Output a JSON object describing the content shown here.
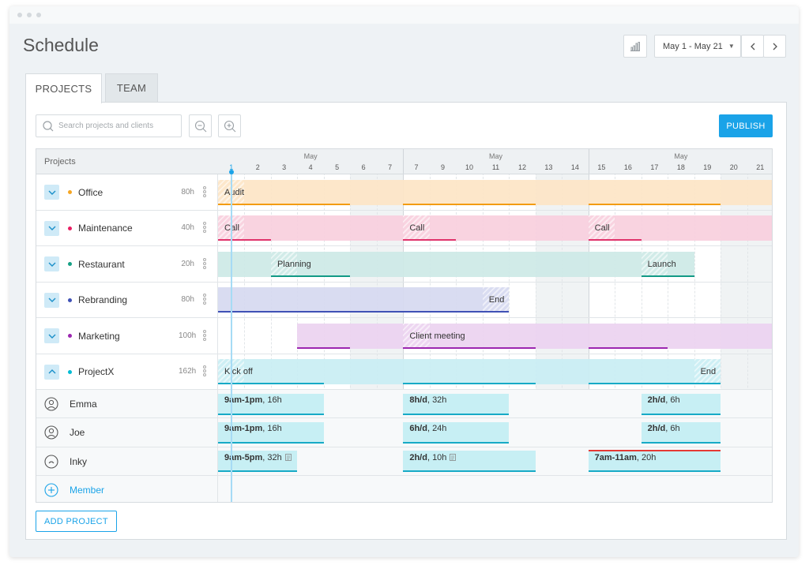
{
  "page": {
    "title": "Schedule"
  },
  "header": {
    "date_range": "May 1 - May 21",
    "prev_icon": "chevron-left-icon",
    "next_icon": "chevron-right-icon",
    "chart_icon": "bar-chart-icon"
  },
  "tabs": [
    {
      "label": "PROJECTS",
      "active": true
    },
    {
      "label": "TEAM",
      "active": false
    }
  ],
  "toolbar": {
    "search_placeholder": "Search projects and clients",
    "publish_label": "PUBLISH",
    "zoom_out_icon": "zoom-out-icon",
    "zoom_in_icon": "zoom-in-icon"
  },
  "grid": {
    "header_label": "Projects",
    "month_label": "May",
    "days": [
      "1",
      "2",
      "3",
      "4",
      "5",
      "6",
      "7",
      "7",
      "9",
      "10",
      "11",
      "12",
      "13",
      "14",
      "15",
      "16",
      "17",
      "18",
      "19",
      "20",
      "21"
    ],
    "weekend_days": [
      6,
      7,
      13,
      14,
      20,
      21
    ],
    "today_day": 1
  },
  "projects": [
    {
      "name": "Office",
      "hours": "80h",
      "color": "#f5a623",
      "expanded": false,
      "bars": [
        {
          "start": 1,
          "end": 21,
          "fill": "#fde5c6",
          "line": "#f39c12",
          "line_segments": [
            [
              1,
              5
            ],
            [
              8,
              12
            ],
            [
              15,
              19
            ]
          ]
        }
      ],
      "labels": [
        {
          "day": 1,
          "text": "Audit"
        }
      ]
    },
    {
      "name": "Maintenance",
      "hours": "40h",
      "color": "#e91e63",
      "expanded": false,
      "bars": [
        {
          "start": 1,
          "end": 21,
          "fill": "#f9cfdd",
          "line": "#e0336b",
          "line_segments": [
            [
              1,
              2
            ],
            [
              8,
              9
            ],
            [
              15,
              16
            ]
          ]
        }
      ],
      "labels": [
        {
          "day": 1,
          "text": "Call"
        },
        {
          "day": 8,
          "text": "Call"
        },
        {
          "day": 15,
          "text": "Call"
        }
      ]
    },
    {
      "name": "Restaurant",
      "hours": "20h",
      "color": "#16a085",
      "expanded": false,
      "bars": [
        {
          "start": 1,
          "end": 18,
          "fill": "#cde9e6",
          "line": "#129a86",
          "line_segments": [
            [
              3,
              5
            ],
            [
              17,
              18
            ]
          ]
        }
      ],
      "labels": [
        {
          "day": 3,
          "text": "Planning"
        },
        {
          "day": 17,
          "text": "Launch"
        }
      ]
    },
    {
      "name": "Rebranding",
      "hours": "80h",
      "color": "#3f51b5",
      "expanded": false,
      "bars": [
        {
          "start": 1,
          "end": 11,
          "fill": "#d6d9f0",
          "line": "#3f51b5",
          "line_segments": [
            [
              1,
              11
            ]
          ]
        }
      ],
      "labels": [
        {
          "day": 11,
          "text": "End"
        }
      ]
    },
    {
      "name": "Marketing",
      "hours": "100h",
      "color": "#9c27b0",
      "expanded": false,
      "bars": [
        {
          "start": 4,
          "end": 21,
          "fill": "#ecd3f0",
          "line": "#9c27b0",
          "line_segments": [
            [
              4,
              5
            ],
            [
              8,
              12
            ],
            [
              15,
              17
            ]
          ]
        }
      ],
      "labels": [
        {
          "day": 8,
          "text": "Client meeting"
        }
      ]
    },
    {
      "name": "ProjectX",
      "hours": "162h",
      "color": "#00bcd4",
      "expanded": true,
      "bars": [
        {
          "start": 1,
          "end": 19,
          "fill": "#c9eef3",
          "line": "#17aac6",
          "line_segments": [
            [
              1,
              4
            ],
            [
              8,
              12
            ],
            [
              15,
              19
            ]
          ]
        }
      ],
      "labels": [
        {
          "day": 1,
          "text": "Kick off"
        },
        {
          "day": 19,
          "text": "End"
        }
      ]
    }
  ],
  "members": [
    {
      "name": "Emma",
      "avatar_icon": "avatar-emma-icon",
      "assignments": [
        {
          "start": 1,
          "end": 4,
          "strong": "9am-1pm",
          "rest": ", 16h"
        },
        {
          "start": 8,
          "end": 11,
          "strong": "8h/d",
          "rest": ", 32h"
        },
        {
          "start": 17,
          "end": 19,
          "strong": "2h/d",
          "rest": ", 6h"
        }
      ]
    },
    {
      "name": "Joe",
      "avatar_icon": "avatar-joe-icon",
      "assignments": [
        {
          "start": 1,
          "end": 4,
          "strong": "9am-1pm",
          "rest": ", 16h"
        },
        {
          "start": 8,
          "end": 11,
          "strong": "6h/d",
          "rest": ", 24h"
        },
        {
          "start": 17,
          "end": 19,
          "strong": "2h/d",
          "rest": ", 6h"
        }
      ]
    },
    {
      "name": "Inky",
      "avatar_icon": "avatar-inky-icon",
      "assignments": [
        {
          "start": 1,
          "end": 3,
          "strong": "9am-5pm",
          "rest": ", 32h",
          "note_icon": true
        },
        {
          "start": 8,
          "end": 12,
          "strong": "2h/d",
          "rest": ", 10h",
          "note_icon": true
        },
        {
          "start": 15,
          "end": 19,
          "strong": "7am-11am",
          "rest": ", 20h",
          "overbooked": true
        }
      ]
    }
  ],
  "add_member_label": "Member",
  "add_project_label": "ADD PROJECT",
  "colors": {
    "accent": "#1aa3e8",
    "overbooked": "#e53935"
  }
}
